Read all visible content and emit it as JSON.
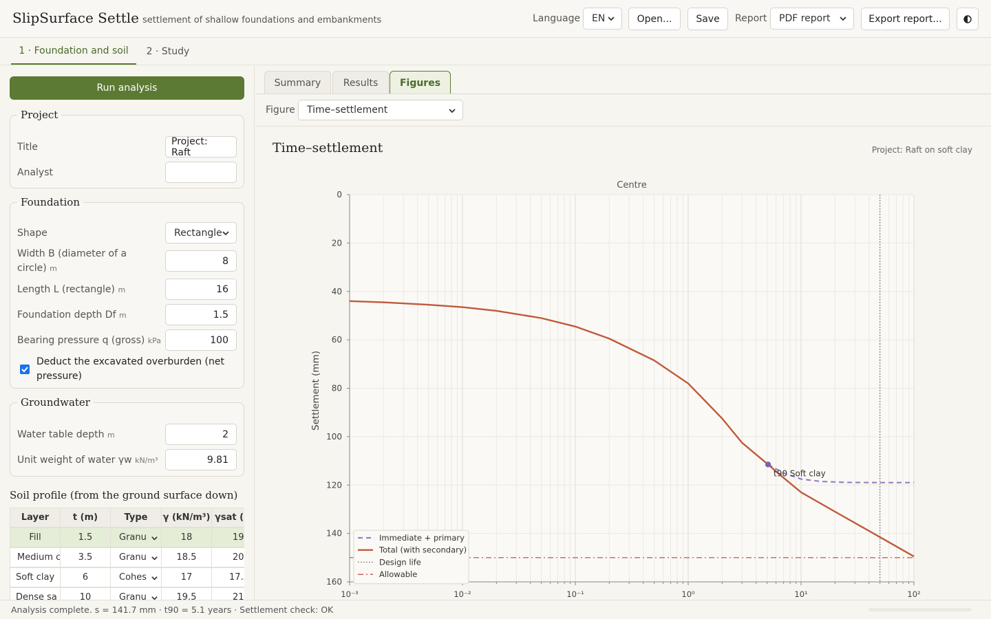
{
  "app": {
    "title": "SlipSurface Settle",
    "subtitle": "settlement of shallow foundations and embankments"
  },
  "toolbar": {
    "language_label": "Language",
    "language_value": "EN",
    "open_label": "Open...",
    "save_label": "Save",
    "report_label": "Report",
    "report_value": "PDF report",
    "export_label": "Export report...",
    "theme_icon": "half-circle-icon"
  },
  "steps": [
    "1 · Foundation and soil",
    "2 · Study"
  ],
  "sidebar": {
    "run_label": "Run analysis",
    "project": {
      "legend": "Project",
      "title_label": "Title",
      "title_value": "Project: Raft",
      "analyst_label": "Analyst",
      "analyst_value": ""
    },
    "foundation": {
      "legend": "Foundation",
      "shape_label": "Shape",
      "shape_value": "Rectangle",
      "width_label": "Width B (diameter of a circle)",
      "width_unit": "m",
      "width_value": "8",
      "length_label": "Length L (rectangle)",
      "length_unit": "m",
      "length_value": "16",
      "depth_label": "Foundation depth Df",
      "depth_unit": "m",
      "depth_value": "1.5",
      "pressure_label": "Bearing pressure q (gross)",
      "pressure_unit": "kPa",
      "pressure_value": "100",
      "deduct_label": "Deduct the excavated overburden (net pressure)",
      "deduct_checked": true
    },
    "groundwater": {
      "legend": "Groundwater",
      "wt_label": "Water table depth",
      "wt_unit": "m",
      "wt_value": "2",
      "gw_label": "Unit weight of water γw",
      "gw_unit": "kN/m³",
      "gw_value": "9.81"
    },
    "soil_profile": {
      "title": "Soil profile (from the ground surface down)",
      "headers": [
        "Layer",
        "t (m)",
        "Type",
        "γ (kN/m³)",
        "γsat (k"
      ],
      "rows": [
        [
          "Fill",
          "1.5",
          "Granu",
          "18",
          "19"
        ],
        [
          "Medium c",
          "3.5",
          "Granu",
          "18.5",
          "20"
        ],
        [
          "Soft clay",
          "6",
          "Cohes",
          "17",
          "17.5"
        ],
        [
          "Dense sa",
          "10",
          "Granu",
          "19.5",
          "21"
        ]
      ]
    }
  },
  "results": {
    "tabs": [
      "Summary",
      "Results",
      "Figures"
    ],
    "active_tab": "Figures",
    "figure_label": "Figure",
    "figure_value": "Time–settlement"
  },
  "chart": {
    "title": "Time–settlement",
    "project": "Project: Raft on soft clay",
    "panel_title": "Centre"
  },
  "chart_data": {
    "type": "line",
    "title": "Centre",
    "xlabel": "",
    "ylabel": "Settlement (mm)",
    "xscale": "log",
    "xlim": [
      0.001,
      100
    ],
    "ylim": [
      0,
      160
    ],
    "y_inverted": true,
    "x_tick_labels": [
      "10⁻³",
      "10⁻²",
      "10⁻¹",
      "10⁰",
      "10¹",
      "10²"
    ],
    "y_ticks": [
      0,
      20,
      40,
      60,
      80,
      100,
      120,
      140,
      160
    ],
    "grid": true,
    "legend_position": "bottom-left",
    "series": [
      {
        "name": "Immediate + primary",
        "style": "dashed",
        "color": "#9b7ec8",
        "x": [
          5.1,
          7,
          10,
          15,
          25,
          50,
          100
        ],
        "y": [
          111.5,
          115,
          117.5,
          118.5,
          118.9,
          119,
          119
        ]
      },
      {
        "name": "Total (with secondary)",
        "style": "solid",
        "color": "#c0593a",
        "x": [
          0.001,
          0.002,
          0.005,
          0.01,
          0.02,
          0.05,
          0.1,
          0.2,
          0.5,
          1,
          2,
          3,
          5.1,
          7,
          10,
          20,
          50,
          100
        ],
        "y": [
          44,
          44.5,
          45.5,
          46.5,
          48,
          51,
          54.5,
          59.5,
          68.5,
          78,
          92.5,
          102.5,
          111.5,
          117,
          123,
          131,
          141.5,
          149.5
        ]
      },
      {
        "name": "Design life",
        "style": "dotted",
        "color": "#666666",
        "x_value": 50
      },
      {
        "name": "Allowable",
        "style": "dashdot",
        "color": "#b8473a",
        "y_value": 150
      }
    ],
    "annotations": [
      {
        "text": "t90 Soft clay",
        "x": 5.1,
        "y": 111.5,
        "marker_color": "#7f5fb8"
      }
    ]
  },
  "status": {
    "text": "Analysis complete. s = 141.7 mm · t90 = 5.1 years · Settlement check: OK"
  }
}
